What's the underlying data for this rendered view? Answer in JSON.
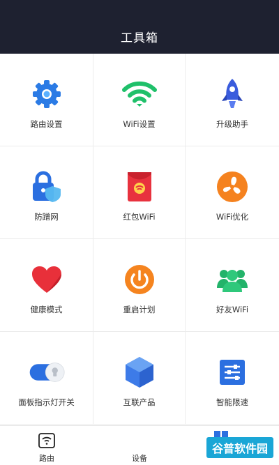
{
  "header": {
    "title": "工具箱"
  },
  "tools": [
    {
      "label": "路由设置",
      "icon": "gear-icon"
    },
    {
      "label": "WiFi设置",
      "icon": "wifi-icon"
    },
    {
      "label": "升级助手",
      "icon": "rocket-icon"
    },
    {
      "label": "防蹭网",
      "icon": "lock-shield-icon"
    },
    {
      "label": "红包WiFi",
      "icon": "red-envelope-icon"
    },
    {
      "label": "WiFi优化",
      "icon": "fan-icon"
    },
    {
      "label": "健康模式",
      "icon": "heart-icon"
    },
    {
      "label": "重启计划",
      "icon": "power-icon"
    },
    {
      "label": "好友WiFi",
      "icon": "friends-icon"
    },
    {
      "label": "面板指示灯开关",
      "icon": "toggle-bulb-icon"
    },
    {
      "label": "互联产品",
      "icon": "cube-icon"
    },
    {
      "label": "智能限速",
      "icon": "speed-limit-icon"
    }
  ],
  "tabbar": {
    "tabs": [
      {
        "label": "路由"
      },
      {
        "label": "设备"
      },
      {
        "label": ""
      }
    ]
  },
  "watermark": {
    "text": "谷普软件园"
  }
}
